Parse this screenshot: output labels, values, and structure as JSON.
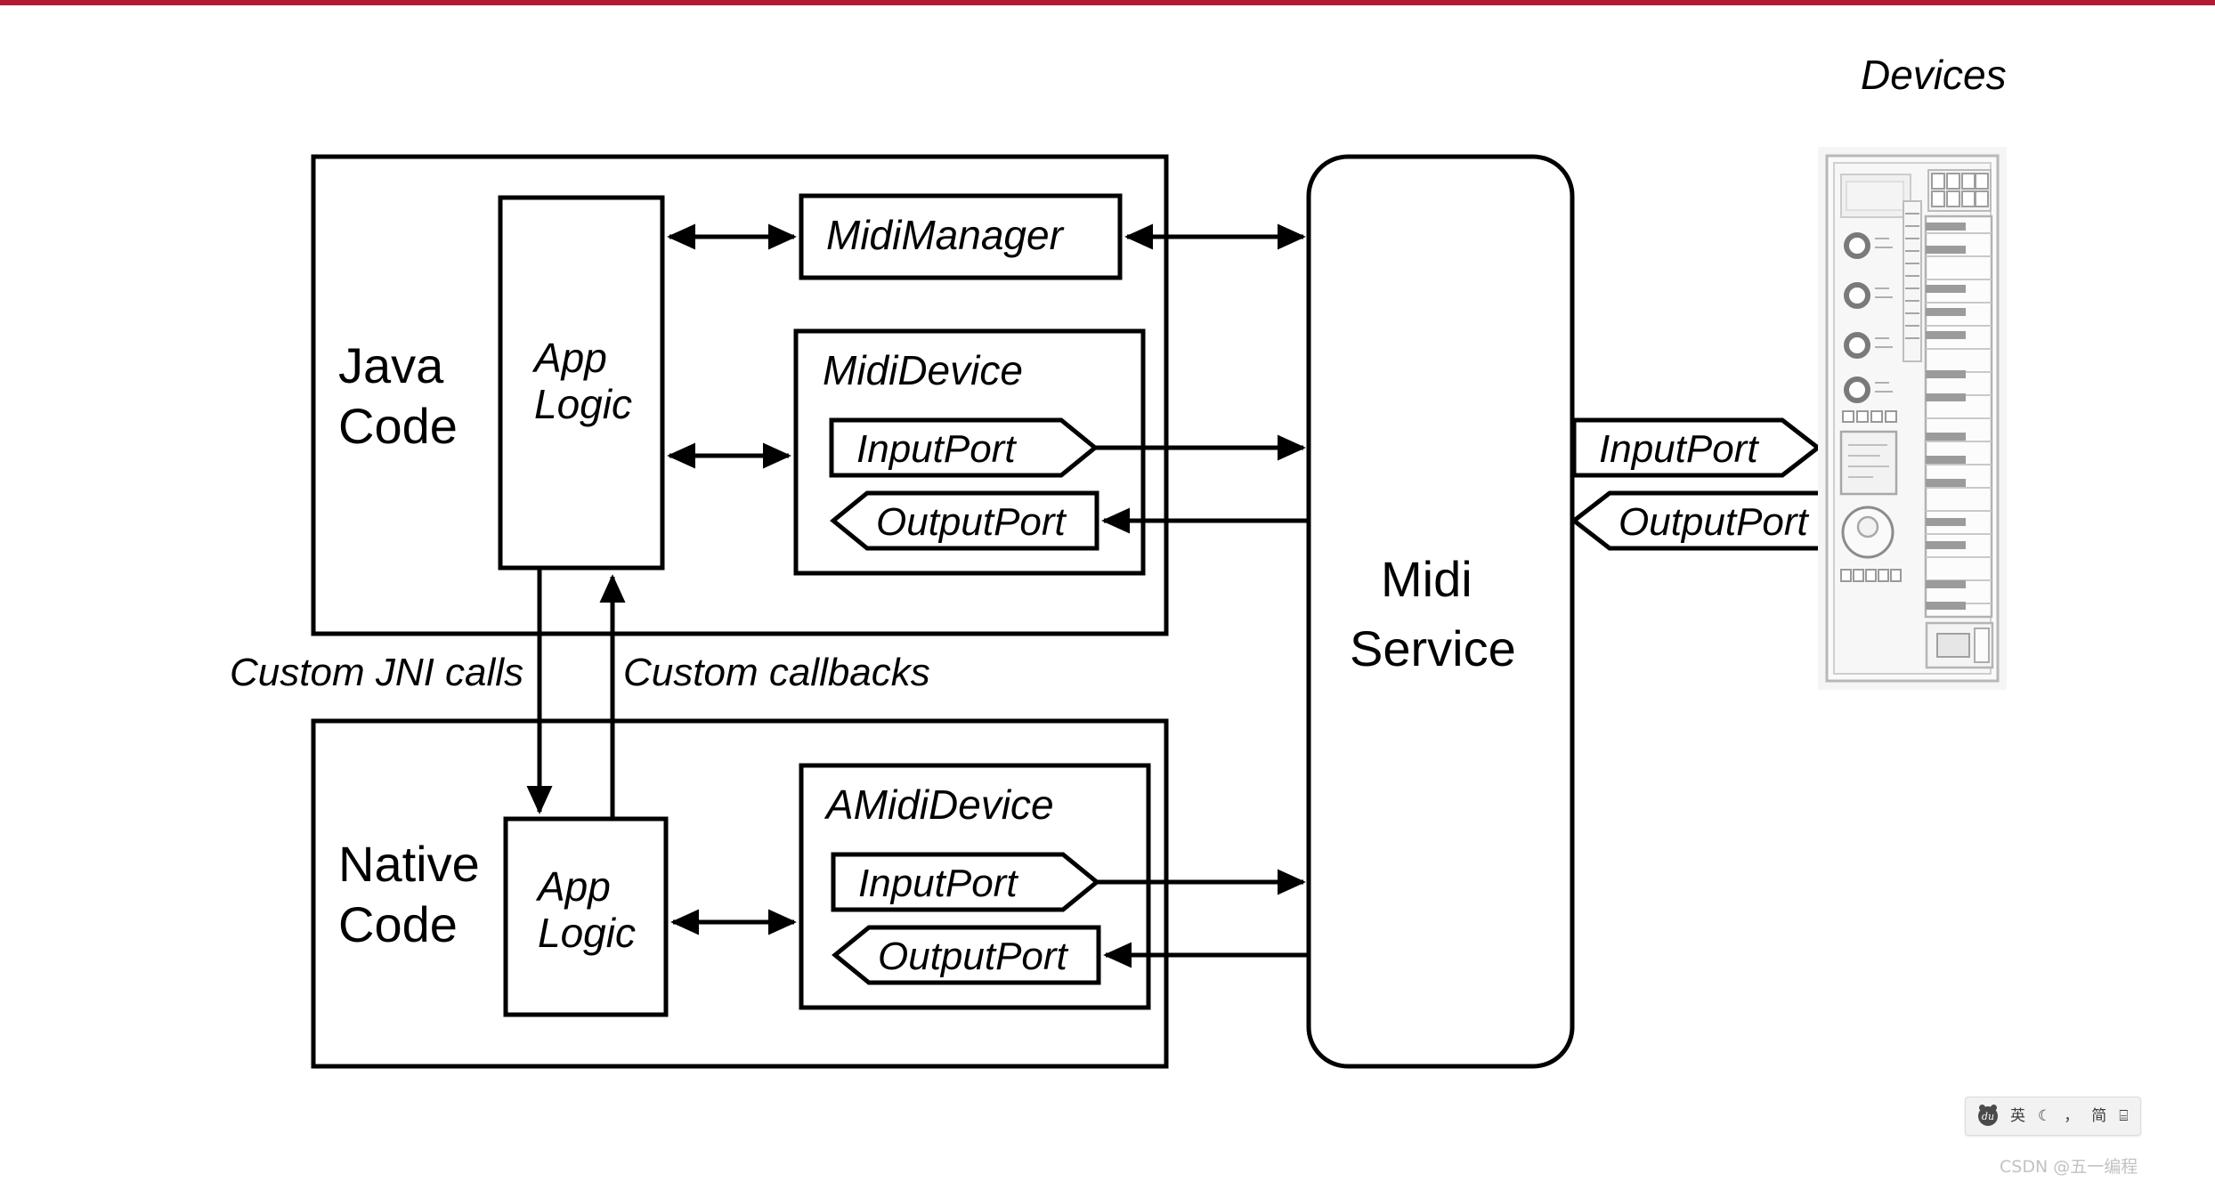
{
  "page": {
    "top_rule_color": "#b31b34",
    "background": "#ffffff",
    "stroke_color": "#000000"
  },
  "diagram": {
    "title_devices": "Devices",
    "containers": [
      {
        "id": "java-code",
        "label": "Java Code",
        "label_lines": [
          "Java",
          "Code"
        ]
      },
      {
        "id": "native-code",
        "label": "Native Code",
        "label_lines": [
          "Native",
          "Code"
        ]
      }
    ],
    "java": {
      "section_label_line1": "Java",
      "section_label_line2": "Code",
      "app_logic_line1": "App",
      "app_logic_line2": "Logic",
      "midi_manager": "MidiManager",
      "midi_device": "MidiDevice",
      "input_port": "InputPort",
      "output_port": "OutputPort"
    },
    "native": {
      "section_label_line1": "Native",
      "section_label_line2": "Code",
      "app_logic_line1": "App",
      "app_logic_line2": "Logic",
      "amidi_device": "AMidiDevice",
      "input_port": "InputPort",
      "output_port": "OutputPort"
    },
    "bridge_labels": {
      "jni": "Custom JNI calls",
      "callbacks": "Custom callbacks"
    },
    "service": {
      "line1": "Midi",
      "line2": "Service"
    },
    "device_ports": {
      "input_port": "InputPort",
      "output_port": "OutputPort"
    }
  },
  "ime_toolbar": {
    "logo_text": "du",
    "items": [
      {
        "name": "language-mode",
        "label": "英"
      },
      {
        "name": "moon-mode",
        "label": "☾"
      },
      {
        "name": "punctuation",
        "label": "，"
      },
      {
        "name": "script-mode",
        "label": "简"
      },
      {
        "name": "keyboard-grid",
        "label": "⌸"
      }
    ]
  },
  "watermark": {
    "text": "CSDN @五一编程"
  }
}
